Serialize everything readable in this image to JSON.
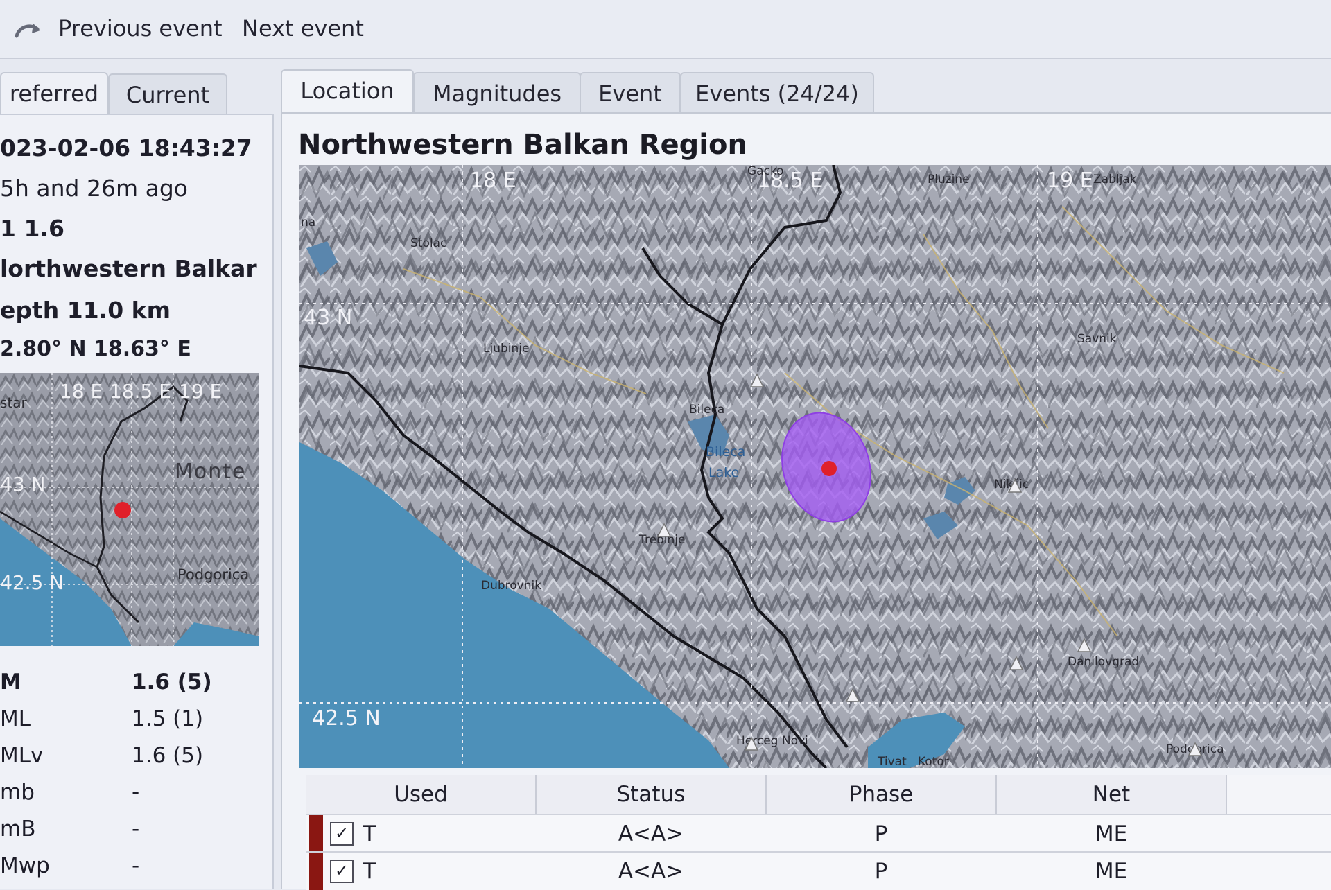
{
  "toolbar": {
    "previous_event": "Previous event",
    "next_event": "Next event"
  },
  "left": {
    "tabs": [
      "referred",
      "Current"
    ],
    "datetime": "023-02-06 18:43:27",
    "ago": "5h and 26m ago",
    "magnitude": "1 1.6",
    "region": "lorthwestern Balkar",
    "depth": "epth  11.0 km",
    "coords": "2.80° N   18.63° E",
    "minimap": {
      "lon_labels": [
        "18 E",
        "18.5 E",
        "19 E"
      ],
      "lat_labels": [
        "43 N",
        "42.5 N"
      ],
      "places": [
        "star",
        "Monte",
        "Podgorica"
      ]
    },
    "magnitudes": [
      {
        "name": "M",
        "value": "1.6 (5)"
      },
      {
        "name": "ML",
        "value": "1.5 (1)"
      },
      {
        "name": "MLv",
        "value": "1.6 (5)"
      },
      {
        "name": "mb",
        "value": "-"
      },
      {
        "name": "mB",
        "value": "-"
      },
      {
        "name": "Mwp",
        "value": "-"
      },
      {
        "name": "Mima",
        "value": ""
      }
    ]
  },
  "tabs": [
    "Location",
    "Magnitudes",
    "Event",
    "Events (24/24)"
  ],
  "region_title": "Northwestern Balkan Region",
  "map": {
    "lon_labels": [
      "18 E",
      "18.5 E",
      "19 E"
    ],
    "lat_labels": [
      "43 N",
      "42.5 N"
    ],
    "places": [
      "Stolac",
      "Ljubinje",
      "Bileca",
      "Bileca",
      "Lake",
      "Trebinje",
      "Dubrovnik",
      "Nikšic",
      "Savnik",
      "Pluzine",
      "Gacko",
      "Zabljak",
      "Danilovgrad",
      "Podgorica",
      "Herceg Novi",
      "Tivat",
      "Kotor",
      "na"
    ]
  },
  "table": {
    "headers": [
      "Used",
      "Status",
      "Phase",
      "Net"
    ],
    "rows": [
      {
        "used": "T",
        "status": "A<A>",
        "phase": "P",
        "net": "ME"
      },
      {
        "used": "T",
        "status": "A<A>",
        "phase": "P",
        "net": "ME"
      }
    ]
  },
  "colors": {
    "accent": "#8a1712",
    "epicenter": "#e0202a",
    "uncertainty": "#a45cf2",
    "sea": "#4d90b9"
  }
}
